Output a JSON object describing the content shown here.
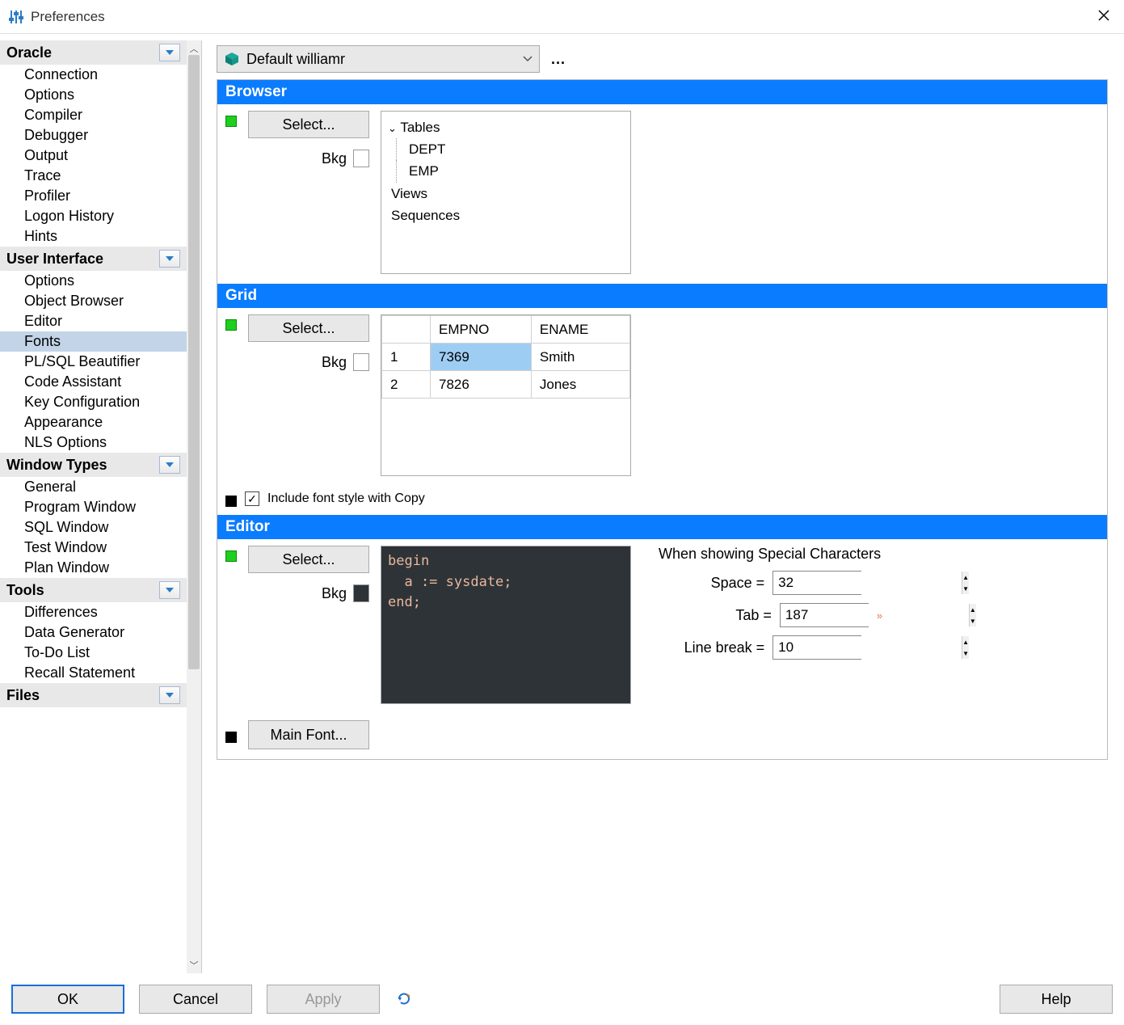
{
  "window": {
    "title": "Preferences"
  },
  "sidebar": {
    "categories": [
      {
        "name": "Oracle",
        "items": [
          "Connection",
          "Options",
          "Compiler",
          "Debugger",
          "Output",
          "Trace",
          "Profiler",
          "Logon History",
          "Hints"
        ]
      },
      {
        "name": "User Interface",
        "items": [
          "Options",
          "Object Browser",
          "Editor",
          "Fonts",
          "PL/SQL Beautifier",
          "Code Assistant",
          "Key Configuration",
          "Appearance",
          "NLS Options"
        ],
        "selected": "Fonts"
      },
      {
        "name": "Window Types",
        "items": [
          "General",
          "Program Window",
          "SQL Window",
          "Test Window",
          "Plan Window"
        ]
      },
      {
        "name": "Tools",
        "items": [
          "Differences",
          "Data Generator",
          "To-Do List",
          "Recall Statement"
        ]
      },
      {
        "name": "Files",
        "items": []
      }
    ]
  },
  "profile": {
    "label": "Default williamr",
    "more": "..."
  },
  "browser": {
    "title": "Browser",
    "select": "Select...",
    "bkg_label": "Bkg",
    "bkg_color": "#ffffff",
    "tree": {
      "root": "Tables",
      "children": [
        "DEPT",
        "EMP"
      ],
      "siblings": [
        "Views",
        "Sequences"
      ]
    }
  },
  "grid": {
    "title": "Grid",
    "select": "Select...",
    "bkg_label": "Bkg",
    "bkg_color": "#ffffff",
    "columns": [
      "",
      "EMPNO",
      "ENAME"
    ],
    "rows": [
      {
        "num": "1",
        "empno": "7369",
        "ename": "Smith",
        "selected_col": "empno"
      },
      {
        "num": "2",
        "empno": "7826",
        "ename": "Jones"
      }
    ],
    "include_label": "Include font style with Copy",
    "include_checked": true
  },
  "editor": {
    "title": "Editor",
    "select": "Select...",
    "bkg_label": "Bkg",
    "bkg_color": "#2e3338",
    "code_line1": "begin",
    "code_line2": "  a := sysdate;",
    "code_line3": "end;",
    "special": {
      "title": "When showing Special Characters",
      "space_label": "Space =",
      "space_value": "32",
      "tab_label": "Tab =",
      "tab_value": "187",
      "break_label": "Line break =",
      "break_value": "10"
    },
    "main_font": "Main Font..."
  },
  "footer": {
    "ok": "OK",
    "cancel": "Cancel",
    "apply": "Apply",
    "help": "Help"
  }
}
